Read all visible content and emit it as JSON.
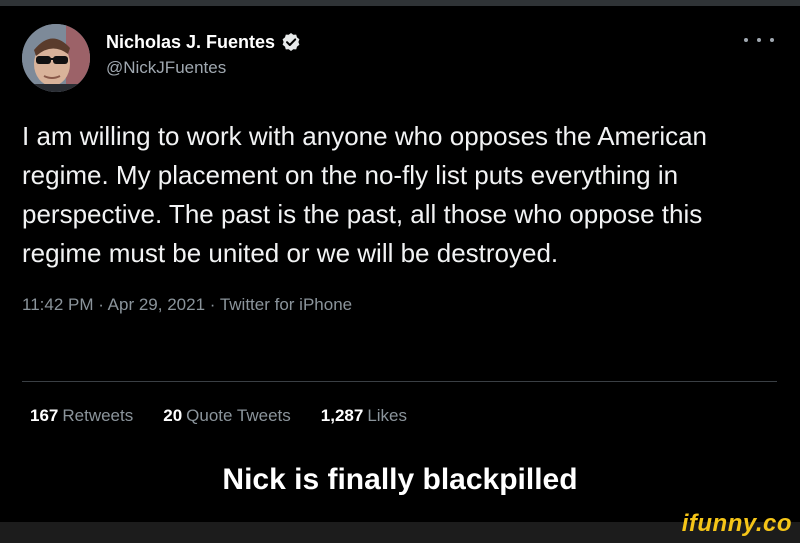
{
  "tweet": {
    "display_name": "Nicholas J. Fuentes",
    "handle": "@NickJFuentes",
    "verified_icon": "verified-badge-icon",
    "more_icon": "more-options-icon",
    "text": "I am willing to work with anyone who opposes the American regime. My placement on the no-fly list puts everything in perspective. The past is the past, all those who oppose this regime must be united or we will be destroyed.",
    "meta": "11:42 PM · Apr 29, 2021 · Twitter for iPhone"
  },
  "stats": [
    {
      "count": "167",
      "label": "Retweets"
    },
    {
      "count": "20",
      "label": "Quote Tweets"
    },
    {
      "count": "1,287",
      "label": "Likes"
    }
  ],
  "caption": "Nick is finally blackpilled",
  "watermark": "ifunny.co",
  "colors": {
    "background": "#000000",
    "verified": "#e7e9ea",
    "watermark": "#f5c518"
  }
}
